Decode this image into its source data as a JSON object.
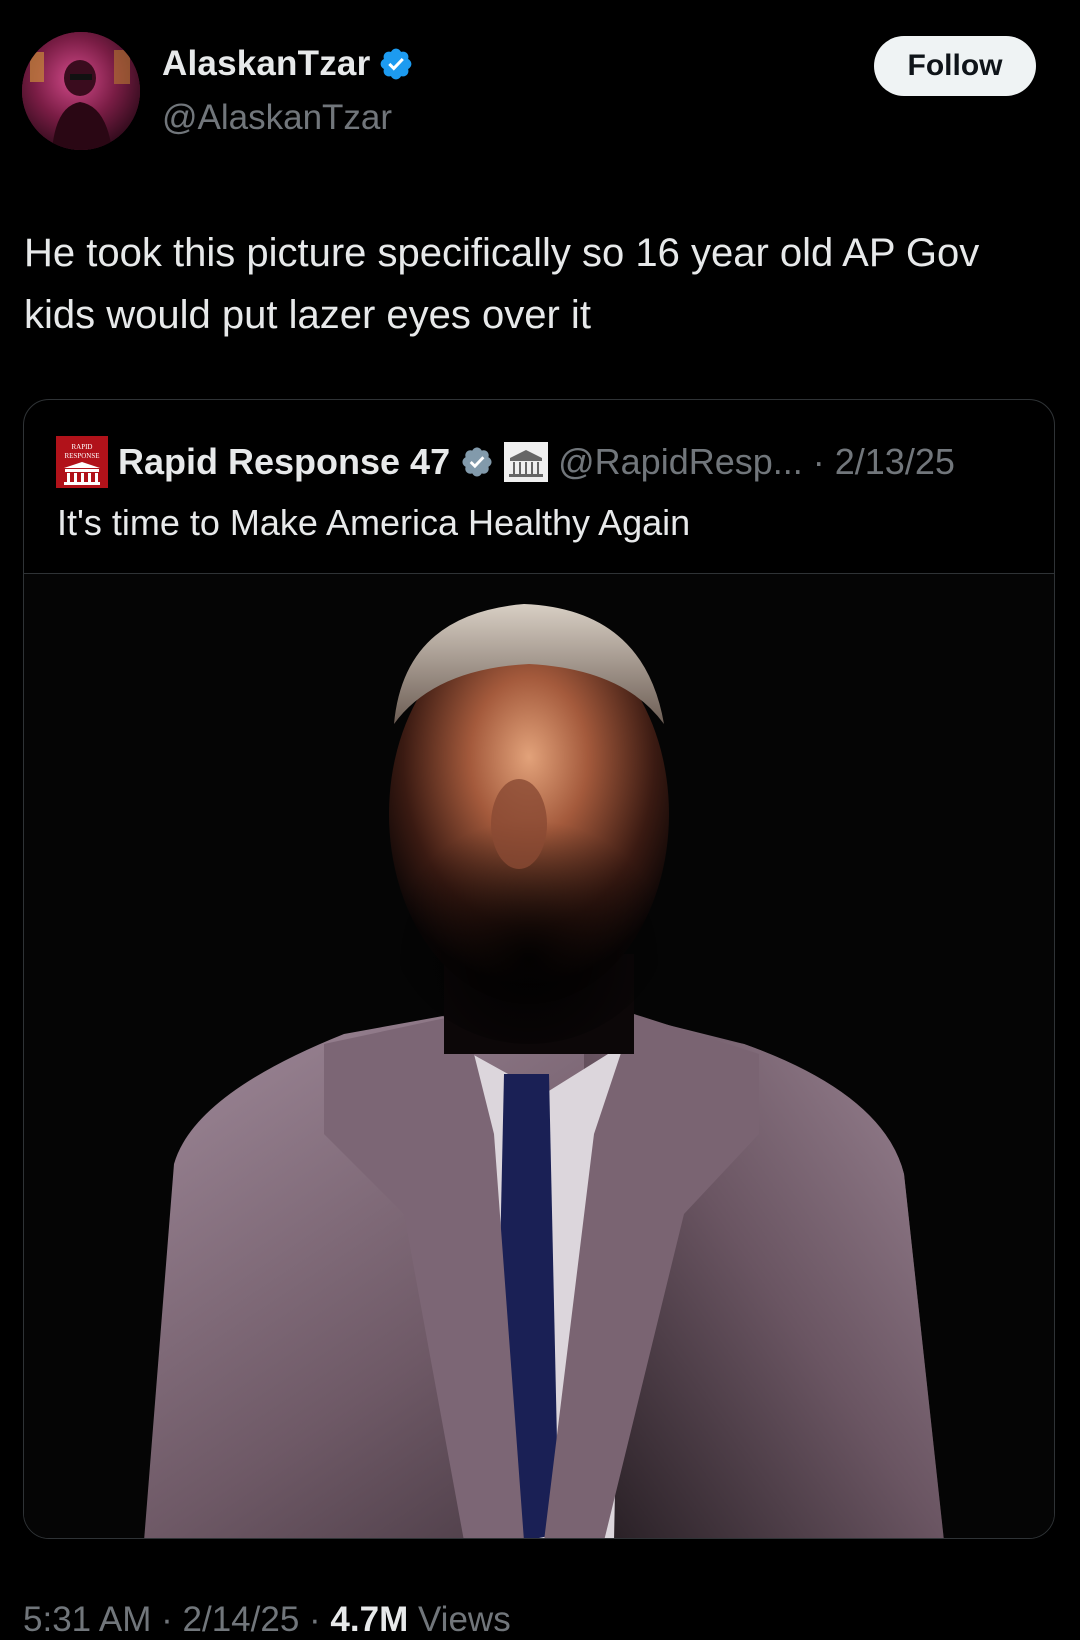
{
  "author": {
    "display_name": "AlaskanTzar",
    "handle": "@AlaskanTzar",
    "verified_icon": "verified-badge-icon",
    "avatar_icon": "avatar"
  },
  "follow_button": {
    "label": "Follow"
  },
  "tweet": {
    "text": "He took this picture specifically so 16 year old AP Gov kids would put lazer eyes over it"
  },
  "quote": {
    "display_name": "Rapid Response 47",
    "handle": "@RapidResp...",
    "separator": "·",
    "date": "2/13/25",
    "text": "It's time to Make America Healthy Again",
    "logo_text": "RAPID RESPONSE",
    "verified_color": "#829aab",
    "media_icon": "portrait-photo"
  },
  "meta": {
    "time": "5:31 AM",
    "sep1": " · ",
    "date": "2/14/25",
    "sep2": " · ",
    "views": "4.7M",
    "views_label": " Views"
  },
  "colors": {
    "background": "#000000",
    "text_primary": "#e7e9ea",
    "text_secondary": "#71767b",
    "verified_blue": "#1d9bf0",
    "border": "#2f3336",
    "follow_bg": "#eff3f4"
  }
}
